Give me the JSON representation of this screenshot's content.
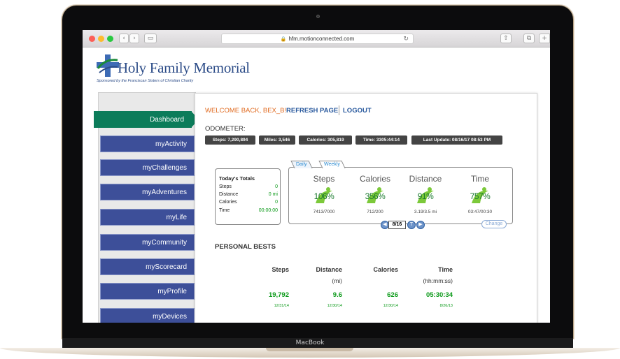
{
  "browser": {
    "url": "hfm.motionconnected.com"
  },
  "brand": {
    "name": "Holy Family Memorial",
    "tagline": "Sponsored by the Franciscan Sisters of Christian Charity"
  },
  "nav": {
    "items": [
      {
        "label": "Dashboard",
        "active": true
      },
      {
        "label": "myActivity"
      },
      {
        "label": "myChallenges"
      },
      {
        "label": "myAdventures"
      },
      {
        "label": "myLife"
      },
      {
        "label": "myCommunity"
      },
      {
        "label": "myScorecard"
      },
      {
        "label": "myProfile"
      },
      {
        "label": "myDevices"
      }
    ]
  },
  "header": {
    "welcome": "WELCOME BACK, BEX_B!",
    "refresh": "REFRESH PAGE",
    "logout": "LOGOUT"
  },
  "odometer": {
    "label": "ODOMETER:",
    "steps": "Steps: 7,290,894",
    "miles": "Miles: 3,546",
    "calories": "Calories: 305,819",
    "time": "Time: 3305:44:14",
    "last_update": "Last Update: 08/16/17 08:53 PM"
  },
  "totals": {
    "title": "Today's Totals",
    "rows": [
      {
        "label": "Steps",
        "value": "0"
      },
      {
        "label": "Distance",
        "value": "0 mi"
      },
      {
        "label": "Calories",
        "value": "0"
      },
      {
        "label": "Time",
        "value": "00:00:00"
      }
    ]
  },
  "stats": {
    "tabs": [
      "Daily",
      "Weekly"
    ],
    "items": [
      {
        "title": "Steps",
        "percent": "106%",
        "value": "7413/7000"
      },
      {
        "title": "Calories",
        "percent": "356%",
        "value": "712/200"
      },
      {
        "title": "Distance",
        "percent": "91%",
        "value": "3.19/3.5 mi"
      },
      {
        "title": "Time",
        "percent": "757%",
        "value": "03:47/00:30"
      }
    ],
    "pager": {
      "prev": "◀",
      "page": "8/16",
      "today": "T",
      "next": "▶"
    },
    "change": "Change"
  },
  "bests": {
    "title": "PERSONAL BESTS",
    "columns": [
      {
        "head": "Steps",
        "sub": "",
        "value": "19,792",
        "date": "12/31/14"
      },
      {
        "head": "Distance",
        "sub": "(mi)",
        "value": "9.6",
        "date": "12/30/14"
      },
      {
        "head": "Calories",
        "sub": "",
        "value": "626",
        "date": "12/30/14"
      },
      {
        "head": "Time",
        "sub": "(hh:mm:ss)",
        "value": "05:30:34",
        "date": "8/26/13"
      }
    ]
  },
  "device": {
    "label": "MacBook"
  },
  "colors": {
    "nav_blue": "#3d4f99",
    "nav_active": "#0c7c5a",
    "accent_green": "#0c9a1a",
    "welcome_orange": "#e06a1f"
  }
}
